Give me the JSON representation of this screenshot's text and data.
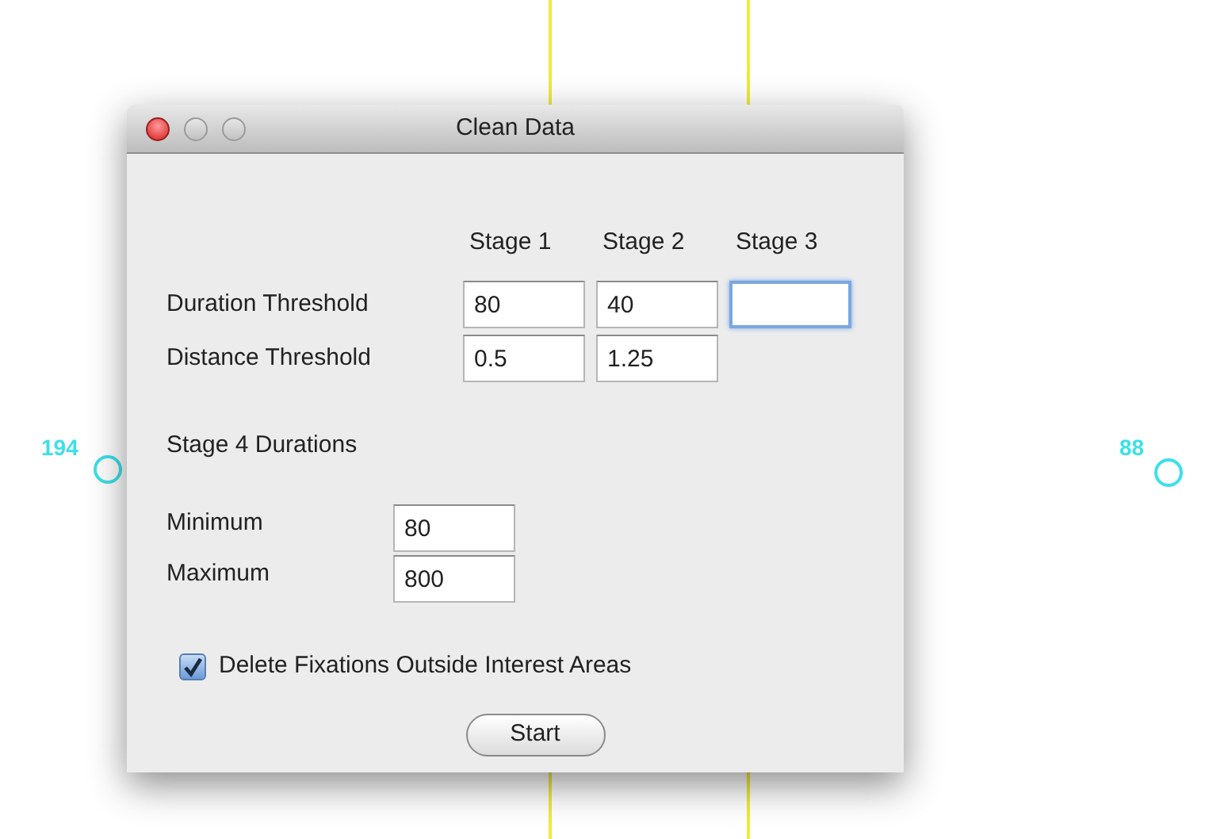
{
  "canvas": {
    "markers": [
      {
        "label": "194"
      },
      {
        "label": "88"
      }
    ]
  },
  "window": {
    "title": "Clean Data"
  },
  "stage_headers": [
    "Stage 1",
    "Stage 2",
    "Stage 3"
  ],
  "thresholds": [
    {
      "label": "Duration Threshold",
      "fields": [
        {
          "value": "80",
          "focused": false
        },
        {
          "value": "40",
          "focused": false
        },
        {
          "focused": true
        }
      ]
    },
    {
      "label": "Distance Threshold",
      "fields": [
        {
          "value": "0.5",
          "focused": false
        },
        {
          "value": "1.25",
          "focused": false
        }
      ]
    }
  ],
  "stage4": {
    "heading": "Stage 4 Durations",
    "rows": [
      {
        "label": "Minimum",
        "value": "80"
      },
      {
        "label": "Maximum",
        "value": "800"
      }
    ]
  },
  "delete_outside": {
    "label": "Delete Fixations Outside Interest Areas",
    "checked": true
  },
  "start_button": {
    "label": "Start"
  }
}
